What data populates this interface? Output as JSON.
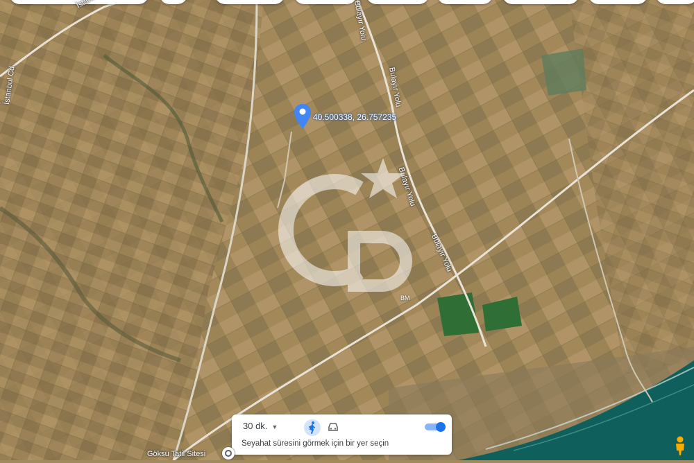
{
  "map": {
    "type": "satellite",
    "coordinates": "40.500338, 26.757235",
    "watermark_mark": "GB",
    "colors": {
      "sea": "#0f5f5c",
      "field": "#a08a5e",
      "forest": "#2f6e35",
      "pin": "#4285f4"
    }
  },
  "labels": {
    "road_istanbul_1": "İstanbul Cd.",
    "road_istanbul_2": "İstanbul Cd.",
    "road_bulayir_1": "Bulayır Yolu",
    "road_bulayir_2": "Bulayır Yolu",
    "road_bulayir_3": "Bulayır Yolu",
    "road_bulayir_4": "Bulayır Yolu",
    "bm": "BM",
    "place": "Göksu Tatil Sitesi"
  },
  "travel_panel": {
    "time_option": "30 dk.",
    "hint": "Seyahat süresini görmek için bir yer seçin",
    "mode_selected": "walking",
    "modes": [
      "walking-icon",
      "car-icon"
    ]
  },
  "icons": {
    "pin": "location-pin-icon",
    "pegman": "pegman-icon",
    "place": "place-marker-icon"
  }
}
